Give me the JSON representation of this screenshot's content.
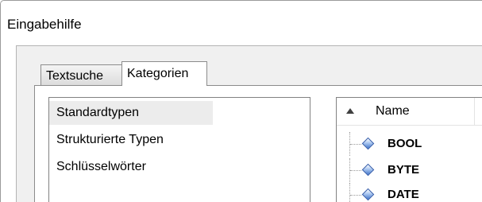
{
  "window": {
    "title": "Eingabehilfe"
  },
  "tabs": [
    {
      "label": "Textsuche",
      "active": false
    },
    {
      "label": "Kategorien",
      "active": true
    }
  ],
  "categories": {
    "items": [
      {
        "label": "Standardtypen",
        "selected": true
      },
      {
        "label": "Strukturierte Typen",
        "selected": false
      },
      {
        "label": "Schlüsselwörter",
        "selected": false
      }
    ]
  },
  "tree": {
    "column_header": "Name",
    "sort": "ascending",
    "icon": "type-diamond-icon",
    "items": [
      {
        "label": "BOOL"
      },
      {
        "label": "BYTE"
      },
      {
        "label": "DATE"
      }
    ]
  },
  "colors": {
    "selection": "#ececec",
    "dialog_background": "#f0f0f0",
    "icon_blue": "#3f73c8"
  }
}
